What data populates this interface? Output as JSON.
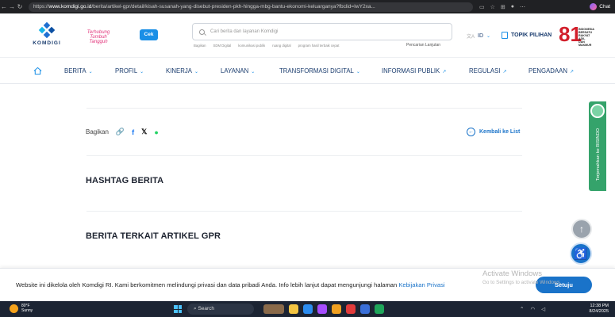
{
  "browser": {
    "url_prefix": "https://",
    "url_domain": "www.komdigi.go.id",
    "url_path": "/berita/artikel-gpr/detail/kisah-susanah-yang-disebut-presiden-pkh-hingga-mbg-bantu-ekonomi-keluarganya?fbclid=IwY2xa...",
    "chat_label": "Chat"
  },
  "header": {
    "logo_text": "KOMDIGI",
    "tagline": "Terhubung Tumbuh Tangguh",
    "cek_label": "Cek",
    "search_placeholder": "Cari berita dan layanan Komdigi",
    "search_hints": [
      "Bagikan",
      "SDM Digital",
      "komunikasi publik",
      "ruang digital",
      "program hasil terbaik cepat"
    ],
    "advanced_search": "Pencarian Lanjutan",
    "lang": "ID",
    "topik_label": "TOPIK PILIHAN",
    "badge_number": "81",
    "badge_text": "INDONESIA BERSATU RAKYAT ADIL DAN MAKMUR"
  },
  "nav": {
    "items": [
      {
        "label": "BERITA",
        "suffix": "⌄"
      },
      {
        "label": "PROFIL",
        "suffix": "⌄"
      },
      {
        "label": "KINERJA",
        "suffix": "⌄"
      },
      {
        "label": "LAYANAN",
        "suffix": "⌄"
      },
      {
        "label": "TRANSFORMASI DIGITAL",
        "suffix": "⌄"
      },
      {
        "label": "INFORMASI PUBLIK",
        "suffix": "↗"
      },
      {
        "label": "REGULASI",
        "suffix": "↗"
      },
      {
        "label": "PENGADAAN",
        "suffix": "↗"
      }
    ]
  },
  "main": {
    "share_label": "Bagikan",
    "back_label": "Kembali ke List",
    "hashtag_heading": "HASHTAG BERITA",
    "related_heading": "BERITA TERKAIT ARTIKEL GPR"
  },
  "side_tab": {
    "label": "Terjemahkan ke BISINDO"
  },
  "cookie": {
    "message": "Website ini dikelola oleh Komdigi RI. Kami berkomitmen melindungi privasi dan data pribadi Anda. Info lebih lanjut dapat mengunjungi halaman ",
    "link": "Kebijakan Privasi",
    "button": "Setuju"
  },
  "watermark": {
    "title": "Activate Windows",
    "sub": "Go to Settings to activate Windows."
  },
  "taskbar": {
    "temp": "80°F",
    "weather": "Sunny",
    "search": "Search",
    "time": "12:38 PM",
    "date": "8/24/2025"
  }
}
